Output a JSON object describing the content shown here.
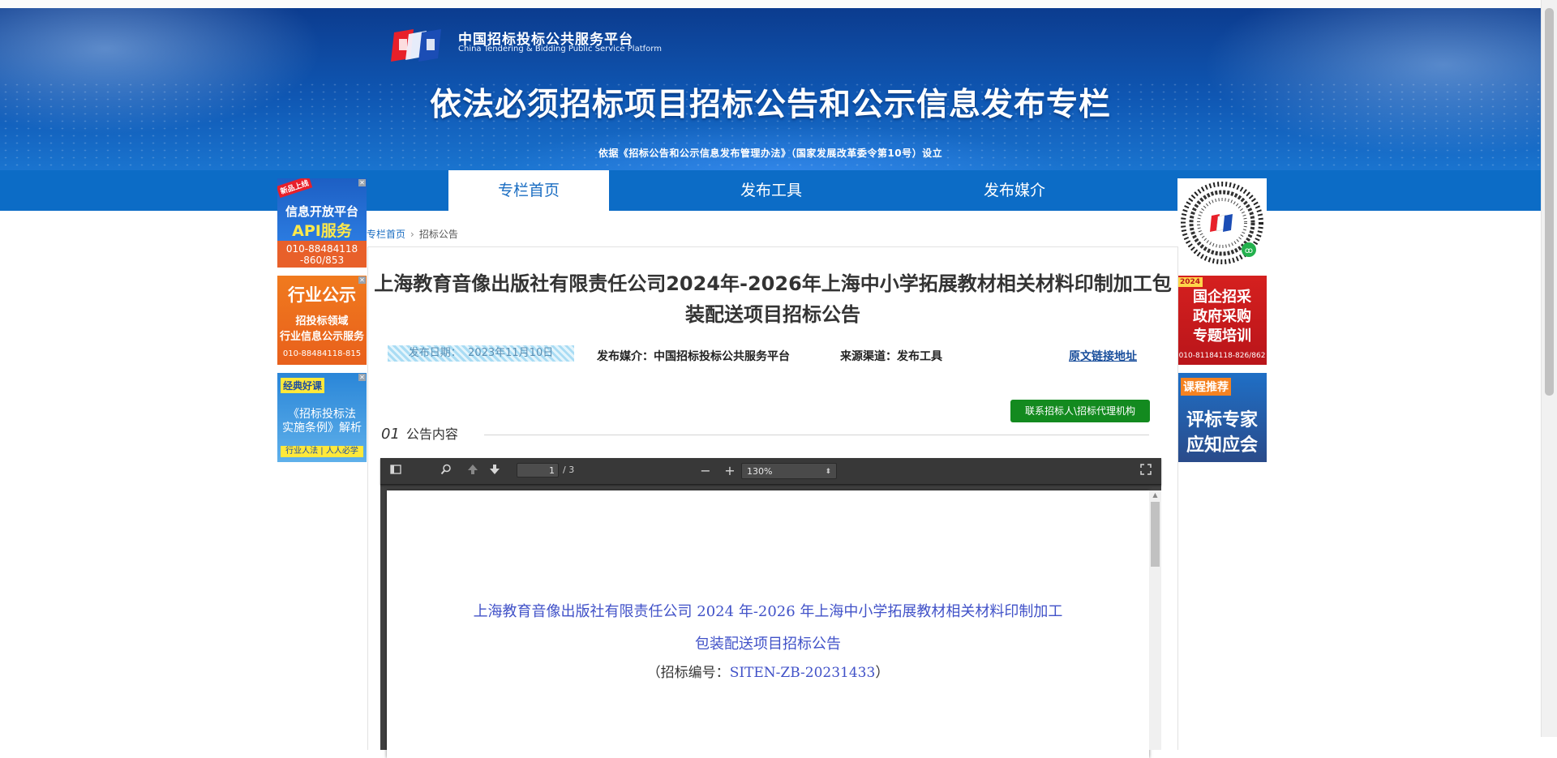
{
  "header": {
    "logo_cn": "中国招标投标公共服务平台",
    "logo_en": "China Tendering & Bidding Public Service Platform",
    "title": "依法必须招标项目招标公告和公示信息发布专栏",
    "subtitle": "依据《招标公告和公示信息发布管理办法》（国家发展改革委令第10号）设立"
  },
  "nav": {
    "items": [
      {
        "label": "专栏首页",
        "active": true
      },
      {
        "label": "发布工具",
        "active": false
      },
      {
        "label": "发布媒介",
        "active": false
      }
    ]
  },
  "left_ads": [
    {
      "tag": "新品上线",
      "line1": "信息开放平台",
      "line2": "API服务",
      "phone": "010-88484118",
      "phone2": "-860/853"
    },
    {
      "line1": "行业公示",
      "line2": "招投标领域",
      "line3": "行业信息公示服务",
      "phone": "010-88484118-815"
    },
    {
      "tag": "经典好课",
      "line1": "《招标投标法",
      "line2": "实施条例》解析",
      "footer": "行业人法 | 人人必学"
    }
  ],
  "right_ads": [
    {
      "type": "qr-code"
    },
    {
      "tag": "2024",
      "line1": "国企招采",
      "line2": "政府采购",
      "line3": "专题培训",
      "phone": "010-81184118-826/862"
    },
    {
      "tag": "课程推荐",
      "line1": "评标专家",
      "line2": "应知应会"
    }
  ],
  "breadcrumb": {
    "home": "专栏首页",
    "current": "招标公告"
  },
  "article": {
    "title": "上海教育音像出版社有限责任公司2024年-2026年上海中小学拓展教材相关材料印制加工包装配送项目招标公告",
    "date_label": "发布日期：",
    "date": "2023年11月10日",
    "media_label": "发布媒介：",
    "media": "中国招标投标公共服务平台",
    "source_label": "来源渠道：",
    "source": "发布工具",
    "original_link": "原文链接地址",
    "contact_button": "联系招标人\\招标代理机构",
    "section_num": "01",
    "section_label": "公告内容"
  },
  "pdf_viewer": {
    "page": "1",
    "total": "/ 3",
    "zoom": "130%",
    "doc_title": "上海教育音像出版社有限责任公司 2024 年-2026 年上海中小学拓展教材相关材料印制加工包装配送项目招标公告",
    "doc_no_label": "（招标编号：",
    "doc_no": "SITEN-ZB-20231433",
    "doc_no_end": "）"
  },
  "colors": {
    "nav_bg": "#0c6cc6",
    "link": "#1a6dc2",
    "contact_button": "#138a1f",
    "pdf_text": "#4152c8"
  }
}
